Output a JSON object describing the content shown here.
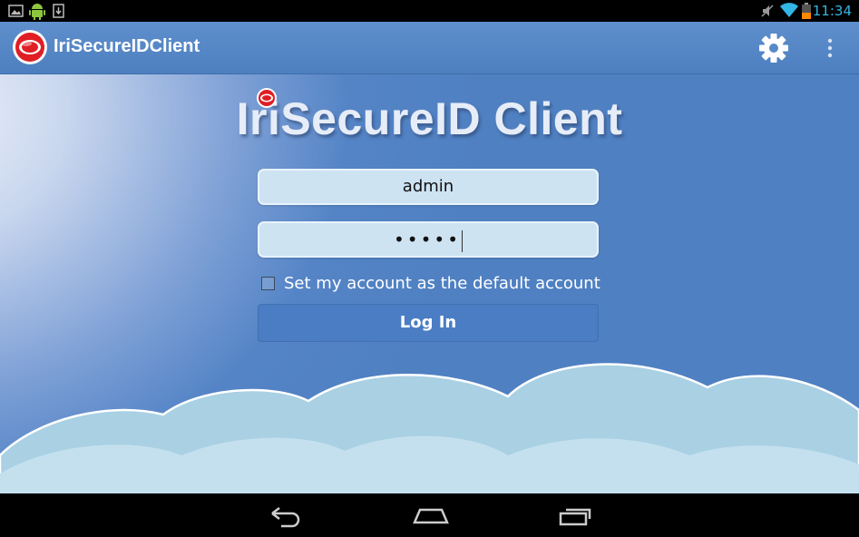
{
  "status_bar": {
    "left_icons": [
      "gallery-icon",
      "android-icon",
      "download-icon"
    ],
    "right_icons": [
      "mute-icon",
      "wifi-icon",
      "battery-icon"
    ],
    "time": "11:34"
  },
  "action_bar": {
    "title": "IriSecureIDClient",
    "logo_icon": "irisecure-logo-icon",
    "actions": [
      "gear-icon",
      "overflow-menu-icon"
    ]
  },
  "login": {
    "brand_heading": "IriSecureID Client",
    "username_value": "admin",
    "password_masked": "•••••",
    "default_account_checked": false,
    "default_account_label": "Set my account as the default account",
    "login_button_label": "Log In"
  },
  "nav_bar": {
    "buttons": [
      "back-icon",
      "home-icon",
      "recent-apps-icon"
    ]
  },
  "colors": {
    "action_bar": "#5889c8",
    "background_blue": "#4f80c2",
    "field_fill": "#cde3f2",
    "button_fill": "#4a7dc3",
    "clock": "#33b5e5"
  }
}
